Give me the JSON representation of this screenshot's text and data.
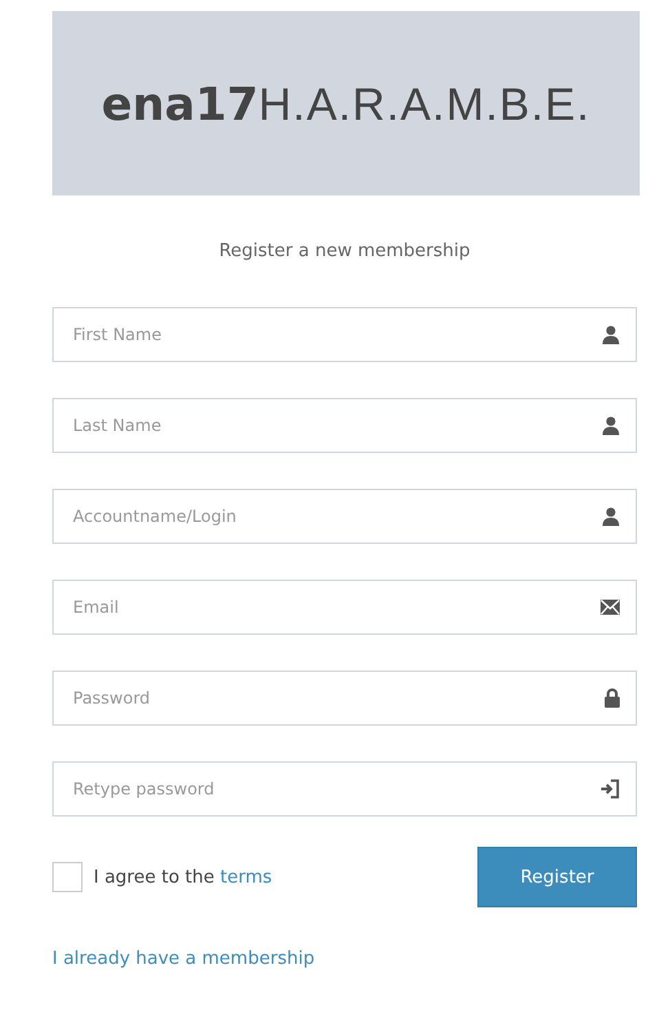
{
  "logo": {
    "bold": "ena17",
    "light": "H.A.R.A.M.B.E."
  },
  "title": "Register a new membership",
  "fields": [
    {
      "placeholder": "First Name",
      "kind": "user"
    },
    {
      "placeholder": "Last Name",
      "kind": "user"
    },
    {
      "placeholder": "Accountname/Login",
      "kind": "user"
    },
    {
      "placeholder": "Email",
      "kind": "email"
    },
    {
      "placeholder": "Password",
      "kind": "password"
    },
    {
      "placeholder": "Retype password",
      "kind": "retype"
    }
  ],
  "agree": {
    "text": "I agree to the ",
    "link": "terms",
    "checked": false
  },
  "register_button": "Register",
  "membership_link": "I already have a membership"
}
